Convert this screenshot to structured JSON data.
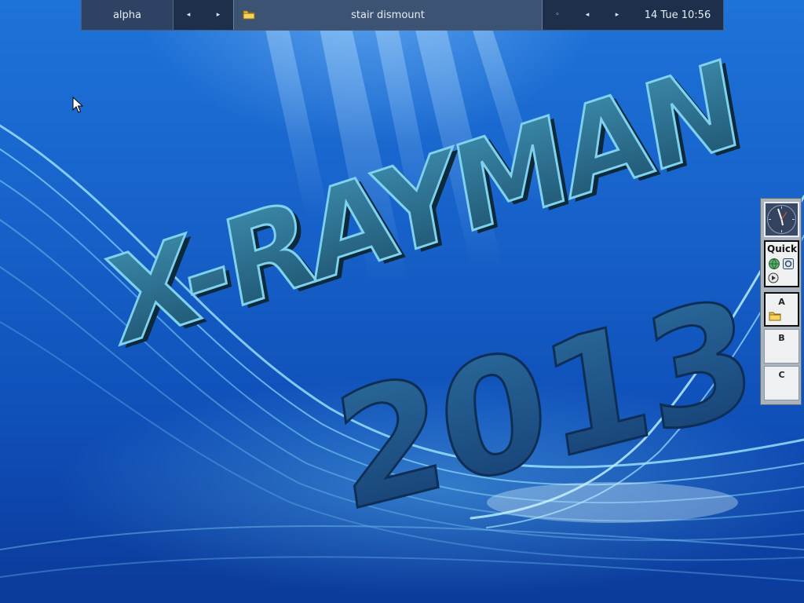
{
  "top_panel": {
    "workspace_name": "alpha",
    "prev_symbol": "◂",
    "next_symbol": "▸",
    "task_title": "stair dismount",
    "task_icon": "folder-icon",
    "menu_symbol": "◦",
    "clock": "14 Tue 10:56"
  },
  "wallpaper": {
    "headline": "X-RAYMAN",
    "year": "2013"
  },
  "dock": {
    "clock_icon": "analog-clock-icon",
    "quick_label": "Quick",
    "quick_icons": [
      "globe-icon",
      "settings-icon",
      "play-icon"
    ],
    "desktops": [
      {
        "label": "A",
        "active": true,
        "icon": "folder-icon"
      },
      {
        "label": "B",
        "active": false
      },
      {
        "label": "C",
        "active": false
      }
    ]
  },
  "colors": {
    "panel_bg": "#1d2f4a",
    "desktop_blue": "#1660c8",
    "dock_bg": "#a9b3bd"
  }
}
